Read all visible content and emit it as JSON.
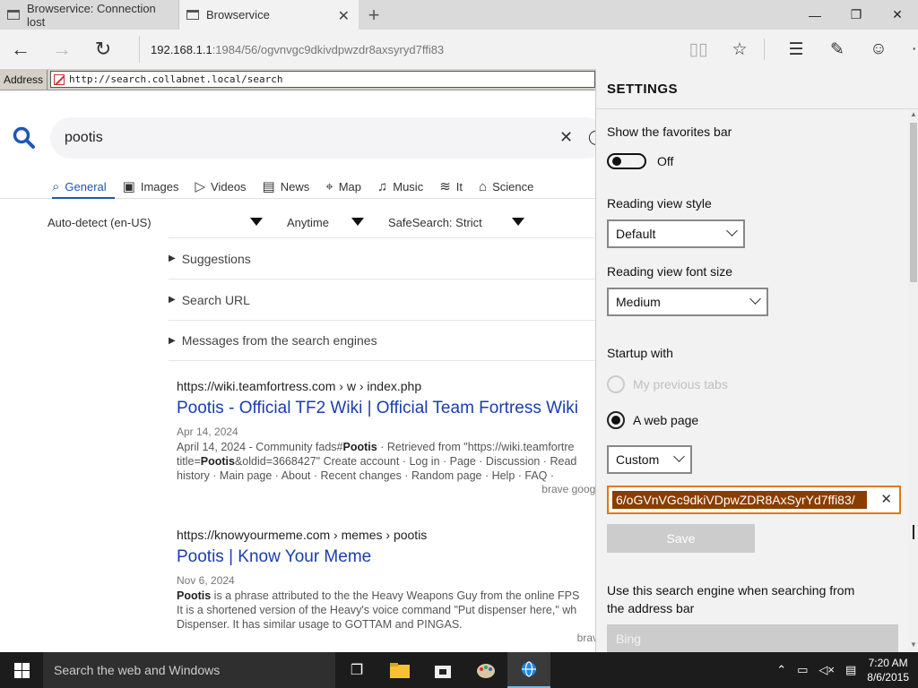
{
  "tabs": [
    {
      "title": "Browservice: Connection lost",
      "active": false
    },
    {
      "title": "Browservice",
      "active": true
    }
  ],
  "window_controls": {
    "minimize": "—",
    "maximize": "❐",
    "close": "✕"
  },
  "nav": {
    "url_host": "192.168.1.1",
    "url_rest": ":1984/56/ogvnvgc9dkivdpwzdr8axsyryd7ffi83"
  },
  "inner_address": {
    "label": "Address",
    "value": "http://search.collabnet.local/search"
  },
  "search": {
    "query": "pootis",
    "categories": [
      {
        "label": "General",
        "icon": "search-icon",
        "active": true
      },
      {
        "label": "Images",
        "icon": "image-icon"
      },
      {
        "label": "Videos",
        "icon": "play-icon"
      },
      {
        "label": "News",
        "icon": "newspaper-icon"
      },
      {
        "label": "Map",
        "icon": "map-pin-icon"
      },
      {
        "label": "Music",
        "icon": "music-icon"
      },
      {
        "label": "It",
        "icon": "layers-icon"
      },
      {
        "label": "Science",
        "icon": "cap-icon"
      }
    ],
    "filters": {
      "language": "Auto-detect (en-US)",
      "time": "Anytime",
      "safesearch": "SafeSearch: Strict"
    },
    "accordions": [
      "Suggestions",
      "Search URL",
      "Messages from the search engines"
    ],
    "results": [
      {
        "url": "https://wiki.teamfortress.com",
        "path": " › w › index.php",
        "title": "Pootis - Official TF2 Wiki | Official Team Fortress Wiki",
        "date": "Apr 14, 2024",
        "desc1_pre": "April 14, 2024 - Community fads#",
        "desc1_bold": "Pootis",
        "desc1_post": " · Retrieved from \"https://wiki.teamfortre",
        "desc2_pre": "title=",
        "desc2_bold": "Pootis",
        "desc2_post": "&oldid=3668427\" Create account · Log in · Page · Discussion · Read",
        "desc3": "history · Main page · About · Recent changes · Random page · Help · FAQ ·",
        "sources": "brave   googl"
      },
      {
        "url": "https://knowyourmeme.com",
        "path": " › memes › pootis",
        "title": "Pootis | Know Your Meme",
        "date": "Nov 6, 2024",
        "desc1_pre": "",
        "desc1_bold": "Pootis",
        "desc1_post": " is a phrase attributed to the the Heavy Weapons Guy from the online FPS",
        "desc2": "It is a shortened version of the Heavy's voice command \"Put dispenser here,\" wh",
        "desc3": "Dispenser. It has similar usage to GOTTAM and PINGAS.",
        "sources": "brav"
      }
    ]
  },
  "settings": {
    "title": "SETTINGS",
    "favorites_label": "Show the favorites bar",
    "favorites_state": "Off",
    "reading_style_label": "Reading view style",
    "reading_style_value": "Default",
    "reading_font_label": "Reading view font size",
    "reading_font_value": "Medium",
    "startup_label": "Startup with",
    "startup_option1": "My previous tabs",
    "startup_option2": "A web page",
    "page_type_value": "Custom",
    "startup_url": "6/oGVnVGc9dkiVDpwZDR8AxSyrYd7ffi83/",
    "save_label": "Save",
    "engine_label_1": "Use this search engine when searching from",
    "engine_label_2": "the address bar",
    "engine_value": "Bing"
  },
  "taskbar": {
    "search_placeholder": "Search the web and Windows",
    "time": "7:20 AM",
    "date": "8/6/2015"
  }
}
